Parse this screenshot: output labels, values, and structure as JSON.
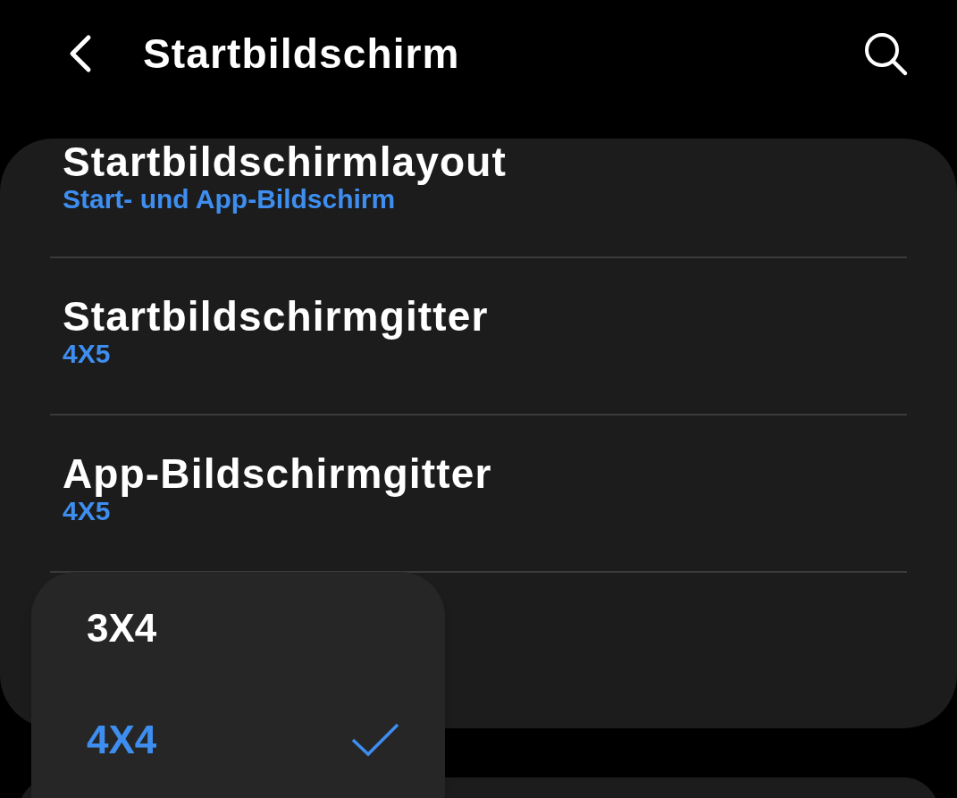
{
  "header": {
    "title": "Startbildschirm"
  },
  "settings": [
    {
      "title": "Startbildschirmlayout",
      "value": "Start- und App-Bildschirm"
    },
    {
      "title": "Startbildschirmgitter",
      "value": "4X5"
    },
    {
      "title": "App-Bildschirmgitter",
      "value": "4X5"
    }
  ],
  "popup": {
    "options": [
      {
        "label": "3X4",
        "selected": false
      },
      {
        "label": "4X4",
        "selected": true
      }
    ]
  }
}
